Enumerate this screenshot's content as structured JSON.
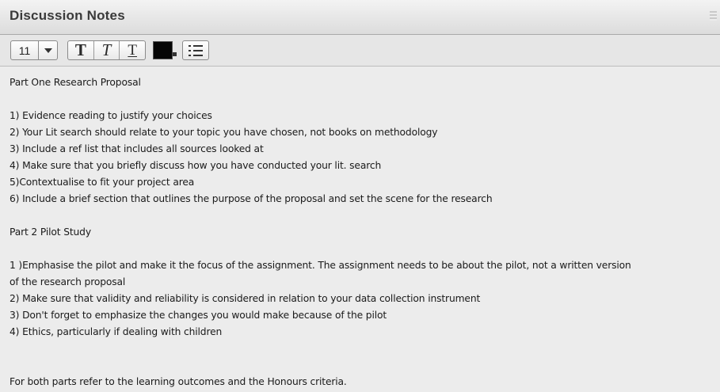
{
  "panel": {
    "title": "Discussion Notes"
  },
  "toolbar": {
    "font_size": "11",
    "bold_glyph": "T",
    "italic_glyph": "T",
    "underline_glyph": "T",
    "text_color": "#050505",
    "icons": [
      "chevron-down-icon",
      "bold-icon",
      "italic-icon",
      "underline-icon",
      "color-swatch",
      "bullet-list-icon"
    ]
  },
  "notes": {
    "part1_heading": "Part One Research Proposal",
    "part1_items": [
      "1) Evidence reading to justify your choices",
      "2) Your Lit search should relate to your topic you have chosen, not books on methodology",
      "3) Include a ref list that includes all sources looked at",
      "4) Make sure that you briefly discuss how you have conducted your lit. search",
      "5)Contextualise to fit your project area",
      "6) Include a brief section that outlines the purpose of the proposal and set the scene for the research"
    ],
    "part2_heading": "Part 2 Pilot Study",
    "part2_items": [
      "1 )Emphasise the pilot and make it the focus of the assignment.  The assignment needs to be about the pilot, not a written version",
      "of the research proposal",
      "2) Make sure that validity and reliability is considered in relation to your data collection instrument",
      "3) Don't forget to emphasize the changes you would make because of the pilot",
      "4) Ethics, particularly if dealing with children"
    ],
    "closing": "For both parts refer to the learning outcomes and the Honours criteria."
  }
}
